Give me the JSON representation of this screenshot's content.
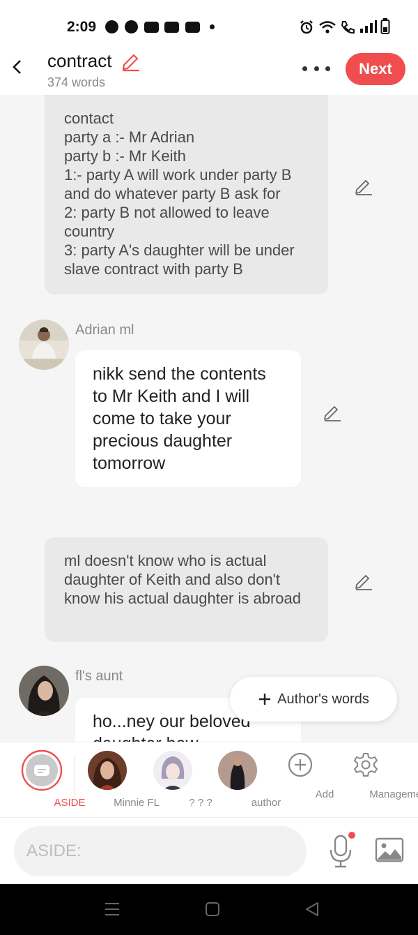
{
  "status_bar": {
    "time": "2:09",
    "left_icons": [
      "jio-icon",
      "chat-bubble-icon",
      "youtube-icon",
      "paytm-icon",
      "app-icon",
      "dot-icon"
    ],
    "right_icons": [
      "alarm-icon",
      "wifi-icon",
      "wifi-call-icon",
      "signal-icon",
      "battery-icon"
    ]
  },
  "header": {
    "title": "contract",
    "word_count": "374 words",
    "next_label": "Next",
    "accent_color": "#f04e4e"
  },
  "messages": [
    {
      "type": "narration",
      "text": "contact\nparty a :- Mr Adrian\nparty b :- Mr Keith\n1:- party A will work under party B and do whatever party B ask for\n2: party B not allowed to leave country\n3: party A's daughter will be under slave contract with party B"
    },
    {
      "type": "dialogue",
      "speaker": "Adrian ml",
      "text": "nikk send the contents to Mr Keith and I will come to take your precious daughter tomorrow"
    },
    {
      "type": "narration",
      "text": "ml doesn't know who is actual daughter of Keith and also don't know his actual daughter is abroad"
    },
    {
      "type": "dialogue",
      "speaker": "fl's aunt",
      "text": "ho...ney our beloved daughter how..."
    }
  ],
  "floating_button": {
    "label": "Author's words"
  },
  "characters": [
    {
      "label": "ASIDE",
      "active": true
    },
    {
      "label": "Minnie FL"
    },
    {
      "label": "? ? ?"
    },
    {
      "label": "author"
    },
    {
      "label": "Add"
    },
    {
      "label": "Management"
    }
  ],
  "input": {
    "placeholder": "ASIDE:"
  }
}
